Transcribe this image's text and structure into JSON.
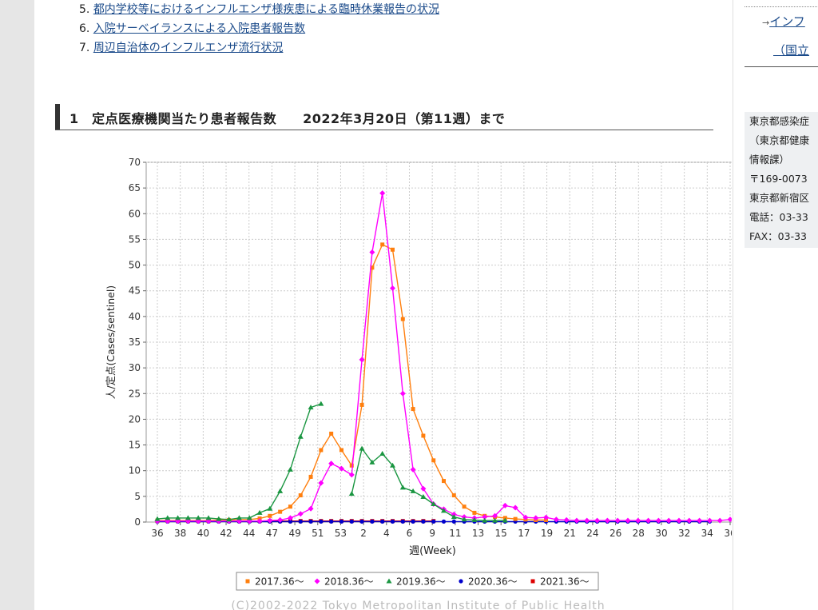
{
  "links": [
    {
      "num": "5.",
      "label": "都内学校等におけるインフルエンザ様疾患による臨時休業報告の状況"
    },
    {
      "num": "6.",
      "label": "入院サーベイランスによる入院患者報告数"
    },
    {
      "num": "7.",
      "label": "周辺自治体のインフルエンザ流行状況"
    }
  ],
  "section": {
    "title": "1　定点医療機関当たり患者報告数　　2022年3月20日（第11週）まで"
  },
  "sidebar": {
    "arrow": "→",
    "link1": "インフ",
    "link2": "（国立",
    "contact": [
      "東京都感染症",
      "（東京都健康",
      "情報課）",
      "〒169-0073",
      "東京都新宿区",
      "電話：03-33",
      "FAX：03-33"
    ]
  },
  "chart_data": {
    "type": "line",
    "ylabel": "人/定点(Cases/sentinel)",
    "xlabel": "週(Week)",
    "copyright": "(C)2002-2022 Tokyo Metropolitan Institute of Public Health",
    "ylim": [
      0,
      70
    ],
    "yticks": [
      0,
      5,
      10,
      15,
      20,
      25,
      30,
      35,
      40,
      45,
      50,
      55,
      60,
      65,
      70
    ],
    "xtick_labels": [
      "36",
      "38",
      "40",
      "42",
      "44",
      "47",
      "49",
      "51",
      "53",
      "2",
      "4",
      "6",
      "9",
      "11",
      "13",
      "15",
      "17",
      "19",
      "21",
      "24",
      "26",
      "28",
      "30",
      "32",
      "34",
      "36"
    ],
    "grid": true,
    "legend_position": "bottom",
    "series": [
      {
        "name": "2017.36～",
        "color": "#ff7f0e",
        "marker": "square",
        "values": [
          0.3,
          0.3,
          0.3,
          0.3,
          0.3,
          0.3,
          0.4,
          0.4,
          0.5,
          0.5,
          0.7,
          1.2,
          2.0,
          3.0,
          5.2,
          8.8,
          14.0,
          17.2,
          14.0,
          11.0,
          22.8,
          49.5,
          54.0,
          53.0,
          39.5,
          22.0,
          16.8,
          12.0,
          8.0,
          5.2,
          3.0,
          1.8,
          1.2,
          1.0,
          0.8,
          0.6,
          0.5,
          0.4,
          0.4
        ]
      },
      {
        "name": "2018.36～",
        "color": "#ff00ff",
        "marker": "diamond",
        "values": [
          0.2,
          0.2,
          0.2,
          0.2,
          0.2,
          0.2,
          0.2,
          0.2,
          0.2,
          0.2,
          0.2,
          0.3,
          0.4,
          0.8,
          1.6,
          2.6,
          7.6,
          11.4,
          10.4,
          9.2,
          31.6,
          52.5,
          64.0,
          45.5,
          25.0,
          10.2,
          6.5,
          3.5,
          2.5,
          1.5,
          1.0,
          0.8,
          1.0,
          1.2,
          3.2,
          2.8,
          0.9,
          0.8,
          0.9,
          0.5,
          0.4,
          0.3,
          0.3,
          0.3,
          0.3,
          0.3,
          0.3,
          0.3,
          0.3,
          0.3,
          0.3,
          0.3,
          0.3,
          0.3,
          0.3,
          0.3,
          0.5
        ]
      },
      {
        "name": "2019.36～",
        "color": "#1a9641",
        "marker": "triangle",
        "values": [
          0.6,
          0.8,
          0.8,
          0.8,
          0.8,
          0.8,
          0.6,
          0.5,
          0.8,
          0.8,
          1.8,
          2.6,
          6.0,
          10.2,
          16.6,
          22.3,
          23.0,
          null,
          null,
          5.5,
          14.3,
          11.6,
          13.3,
          11.0,
          6.7,
          6.0,
          4.9,
          3.5,
          2.2,
          1.0,
          0.5,
          0.4,
          0.3,
          0.3,
          0.3
        ]
      },
      {
        "name": "2020.36～",
        "color": "#0000cc",
        "marker": "circle",
        "values": [
          0.1,
          0.1,
          0.1,
          0.1,
          0.1,
          0.1,
          0.1,
          0.1,
          0.1,
          0.1,
          0.1,
          0.1,
          0.1,
          0.1,
          0.1,
          0.1,
          0.1,
          0.1,
          0.1,
          0.1,
          0.1,
          0.1,
          0.1,
          0.1,
          0.1,
          0.1,
          0.1,
          0.1,
          0.1,
          0.1,
          0.1,
          0.1,
          0.1,
          0.1,
          0.1,
          0.1,
          0.1,
          0.1,
          0.1,
          0.1,
          0.1,
          0.1,
          0.1,
          0.1,
          0.1,
          0.1,
          0.1,
          0.1,
          0.1,
          0.1,
          0.1,
          0.1,
          0.1,
          0.1,
          0.1
        ]
      },
      {
        "name": "2021.36～",
        "color": "#dd0000",
        "marker": "square",
        "values": [
          0.2,
          0.2,
          0.2,
          0.2,
          0.2,
          0.2,
          0.2,
          0.2,
          0.2,
          0.2,
          0.2,
          0.2,
          0.2,
          0.2,
          0.2,
          0.2,
          0.2,
          0.2,
          0.2,
          0.2,
          0.2,
          0.2,
          0.2,
          0.2,
          0.2,
          0.2,
          0.2,
          0.2
        ]
      }
    ]
  }
}
